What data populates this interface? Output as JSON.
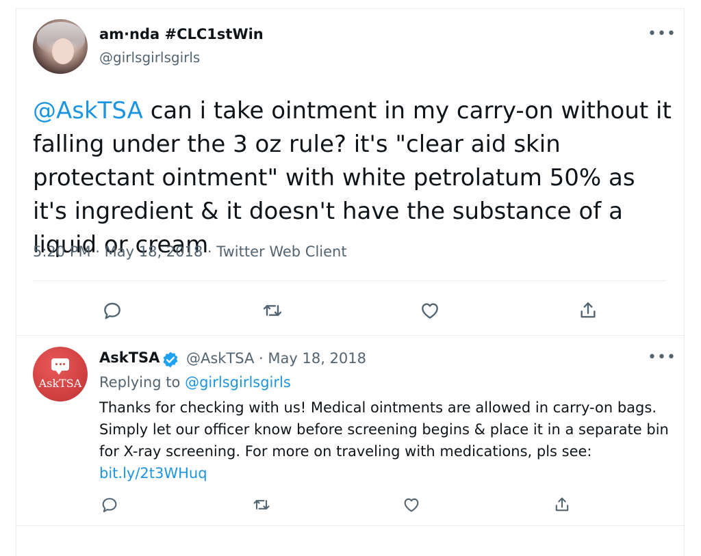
{
  "tweet": {
    "author_name": "am·nda #CLC1stWin",
    "author_handle": "@girlsgirlsgirls",
    "more": "•••",
    "mention": "@AskTSA",
    "text": " can i take ointment in my carry-on without it falling under the 3 oz rule? it's \"clear aid skin protectant ointment\" with white petrolatum 50% as it's ingredient & it doesn't have the substance of a liquid or cream",
    "meta": "5:20 PM · May 18, 2018 · Twitter Web Client",
    "actions": [
      "reply-icon",
      "retweet-icon",
      "like-icon",
      "share-icon"
    ]
  },
  "reply": {
    "avatar_text": "AskTSA",
    "author_name": "AskTSA",
    "handle_date": "@AskTSA · May 18, 2018",
    "more": "•••",
    "replying_prefix": "Replying to ",
    "replying_handle": "@girlsgirlsgirls",
    "text": "Thanks for checking with us! Medical ointments are allowed in carry-on bags. Simply let our officer know before screening begins & place it in a separate bin for X-ray screening. For more on traveling with medications, pls see: ",
    "link": "bit.ly/2t3WHuq",
    "actions": [
      "reply-icon",
      "retweet-icon",
      "like-icon",
      "share-icon"
    ]
  },
  "colors": {
    "link": "#1b95e0",
    "secondary": "#536471",
    "text": "#0f1419",
    "verified": "#1da1f2"
  }
}
